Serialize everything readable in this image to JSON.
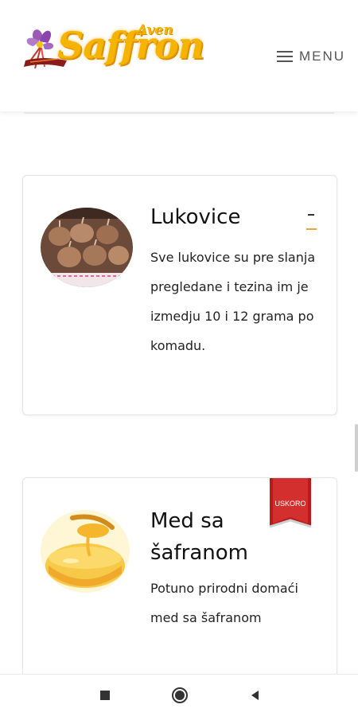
{
  "header": {
    "logo_text": "Saffron",
    "logo_subtext": "Aven",
    "menu_label": "MENU"
  },
  "products": [
    {
      "title": "Lukovice",
      "description": "Sve lukovice su pre slanja pregledane i tezina im je izmedju 10 i 12 grama po komadu.",
      "toggle_icon": "minus-icon"
    },
    {
      "title": "Med sa šafranom",
      "description": "Potuno prirodni domaći med sa šafranom",
      "badge": "USKORO"
    }
  ],
  "navbar": {
    "icons": [
      "square-icon",
      "circle-icon",
      "triangle-back-icon"
    ]
  },
  "colors": {
    "accent": "#f2a535",
    "logo": "#f4b400",
    "badge": "#d32f2f"
  }
}
